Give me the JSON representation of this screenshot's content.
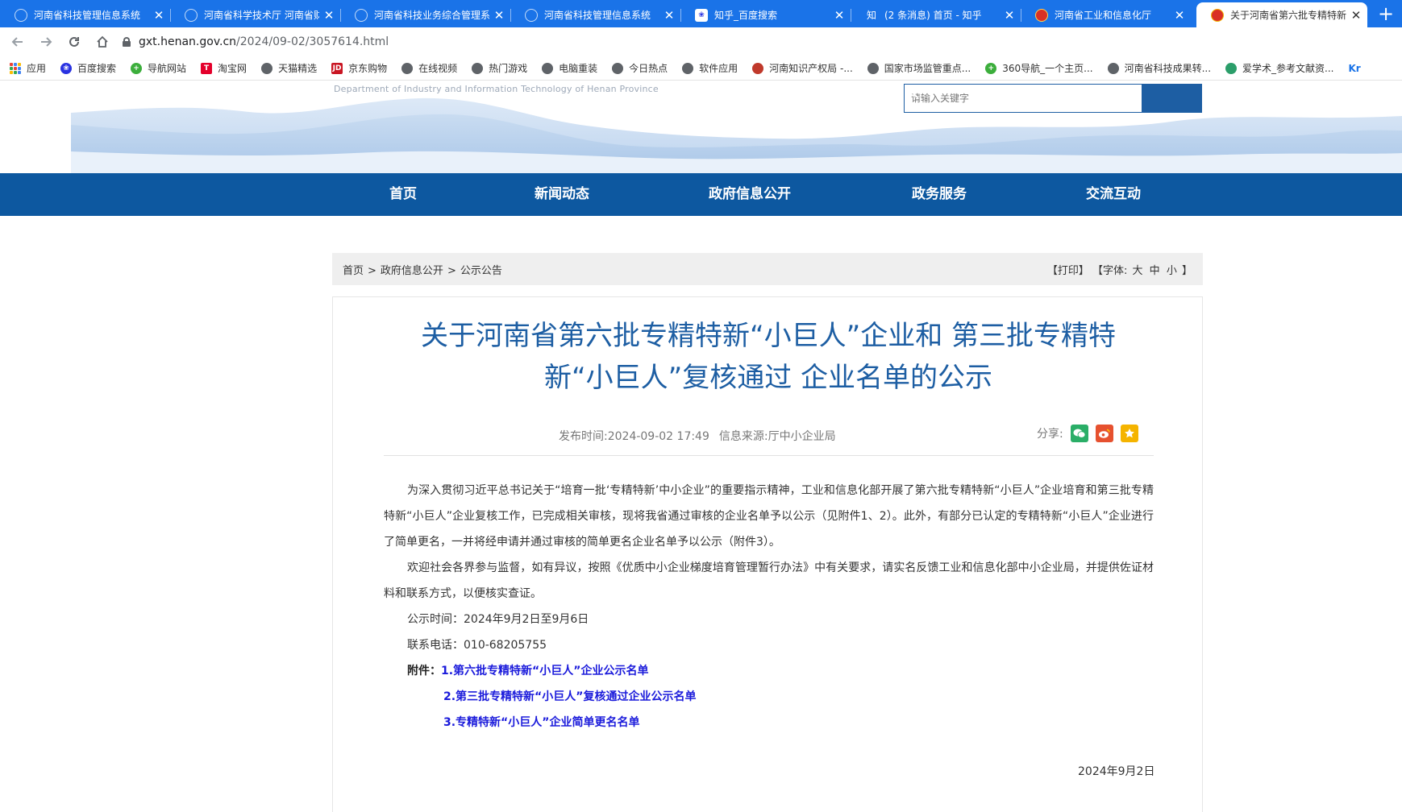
{
  "browser": {
    "tabs": [
      {
        "title": "河南省科技管理信息系统",
        "active": false
      },
      {
        "title": "河南省科学技术厅 河南省财",
        "active": false
      },
      {
        "title": "河南省科技业务综合管理系",
        "active": false
      },
      {
        "title": "河南省科技管理信息系统",
        "active": false
      },
      {
        "title": "知乎_百度搜索",
        "active": false
      },
      {
        "title": "(2 条消息) 首页 - 知乎",
        "active": false
      },
      {
        "title": "河南省工业和信息化厅",
        "active": false
      },
      {
        "title": "关于河南省第六批专精特新",
        "active": true
      }
    ],
    "url_host": "gxt.henan.gov.cn",
    "url_path": "/2024/09-02/3057614.html",
    "bookmarks": [
      "应用",
      "百度搜索",
      "导航网站",
      "淘宝网",
      "天猫精选",
      "京东购物",
      "在线视频",
      "热门游戏",
      "电脑重装",
      "今日热点",
      "软件应用",
      "河南知识产权局 -...",
      "国家市场监管重点...",
      "360导航_一个主页...",
      "河南省科技成果转...",
      "爱学术_参考文献资...",
      "Kr"
    ]
  },
  "header": {
    "dept_en": "Department of Industry and Information Technology of Henan Province",
    "search_placeholder": "请输入关键字"
  },
  "nav": [
    "首页",
    "新闻动态",
    "政府信息公开",
    "政务服务",
    "交流互动"
  ],
  "breadcrumb": {
    "items": [
      "首页",
      "政府信息公开",
      "公示公告"
    ],
    "sep": ">",
    "print": "【打印】",
    "font_label": "【字体:",
    "font_large": "大",
    "font_medium": "中",
    "font_small": "小",
    "font_close": "】"
  },
  "article": {
    "title_line1": "关于河南省第六批专精特新“小巨人”企业和 第三批专精特",
    "title_line2": "新“小巨人”复核通过 企业名单的公示",
    "publish_label": "发布时间:",
    "publish_time": "2024-09-02 17:49",
    "source_label": "信息来源:",
    "source": "厅中小企业局",
    "share_label": "分享:",
    "para1": "为深入贯彻习近平总书记关于“培育一批‘专精特新’中小企业”的重要指示精神，工业和信息化部开展了第六批专精特新“小巨人”企业培育和第三批专精特新“小巨人”企业复核工作，已完成相关审核，现将我省通过审核的企业名单予以公示（见附件1、2）。此外，有部分已认定的专精特新“小巨人”企业进行了简单更名，一并将经申请并通过审核的简单更名企业名单予以公示（附件3）。",
    "para2": "欢迎社会各界参与监督，如有异议，按照《优质中小企业梯度培育管理暂行办法》中有关要求，请实名反馈工业和信息化部中小企业局，并提供佐证材料和联系方式，以便核实查证。",
    "para3": "公示时间：2024年9月2日至9月6日",
    "para4": "联系电话：010-68205755",
    "attach_label": "附件：",
    "attachments": [
      "1.第六批专精特新“小巨人”企业公示名单",
      "2.第三批专精特新“小巨人”复核通过企业公示名单",
      "3.专精特新“小巨人”企业简单更名名单"
    ],
    "sign_date": "2024年9月2日"
  },
  "colors": {
    "tabbar": "#1a73e8",
    "nav_blue": "#0d58a0",
    "title_blue": "#1d5ea3",
    "link_blue": "#1a1adb"
  }
}
